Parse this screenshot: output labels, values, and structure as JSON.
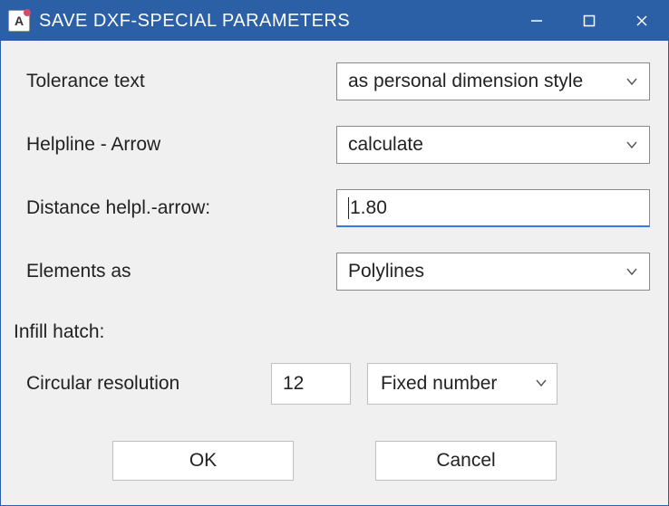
{
  "titlebar": {
    "app_icon_letter": "A",
    "title": "SAVE DXF-SPECIAL PARAMETERS"
  },
  "form": {
    "tolerance_text": {
      "label": "Tolerance text",
      "value": "as personal dimension style"
    },
    "helpline_arrow": {
      "label": "Helpline - Arrow",
      "value": "calculate"
    },
    "distance_helpl_arrow": {
      "label": "Distance helpl.-arrow:",
      "value": "1.80"
    },
    "elements_as": {
      "label": "Elements as",
      "value": "Polylines"
    }
  },
  "infill": {
    "section": "Infill hatch:",
    "circular_resolution": {
      "label": "Circular resolution",
      "count": "12",
      "mode": "Fixed number"
    }
  },
  "buttons": {
    "ok": "OK",
    "cancel": "Cancel"
  }
}
